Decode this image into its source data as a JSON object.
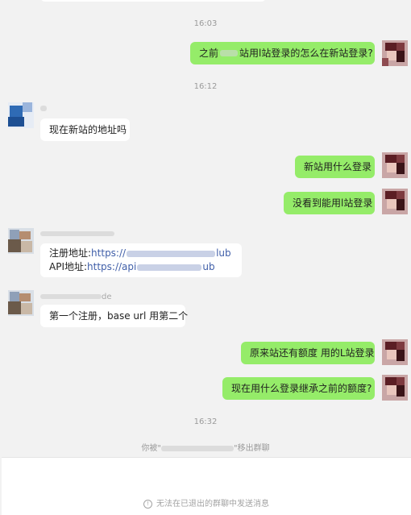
{
  "conversation": {
    "times": [
      "16:03",
      "16:12",
      "16:32"
    ],
    "messages": [
      {
        "text_a": "之前",
        "text_b": "站用l站登录的怎么在新站登录?"
      },
      {
        "sender_name": "",
        "text": "现在新站的地址吗"
      },
      {
        "text": "新站用什么登录"
      },
      {
        "text": "没看到能用l站登录"
      },
      {
        "sender_name_tail": "",
        "line1_label": "注册地址:",
        "line1_link_a": "https://",
        "line1_link_b": "lub",
        "line2_label": "API地址:",
        "line2_link_a": "https://api",
        "line2_link_b": "ub"
      },
      {
        "sender_name_tail": "de",
        "text": "第一个注册，base url 用第二个"
      },
      {
        "text": "原来站还有额度 用的L站登录"
      },
      {
        "text": "现在用什么登录继承之前的额度?"
      }
    ],
    "system_notice": {
      "prefix": "你被\"",
      "suffix": "\"移出群聊"
    }
  },
  "composer": {
    "info_icon_glyph": "!",
    "disabled_message": "无法在已退出的群聊中发送消息"
  },
  "colors": {
    "outgoing_bubble": "#95ec69",
    "incoming_bubble": "#ffffff",
    "background": "#f2f2f2"
  }
}
